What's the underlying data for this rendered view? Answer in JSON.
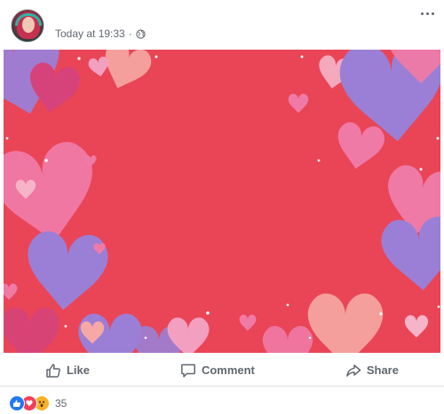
{
  "post": {
    "timestamp": "Today at 19:33",
    "separator": "·",
    "privacy_icon": "globe-icon",
    "options_icon": "more-options-icon"
  },
  "media": {
    "background_color": "#e94557",
    "heart_colors": [
      "#9b7fd6",
      "#f07aa6",
      "#f3a0c0",
      "#d6427a",
      "#f6b4c8"
    ]
  },
  "actions": {
    "like_label": "Like",
    "comment_label": "Comment",
    "share_label": "Share"
  },
  "reactions": {
    "types": [
      "like",
      "love",
      "wow"
    ],
    "count": "35"
  },
  "colors": {
    "text_secondary": "#616770",
    "like_blue": "#2078f4",
    "love_red": "#f33e58",
    "wow_yellow": "#f7b125"
  }
}
